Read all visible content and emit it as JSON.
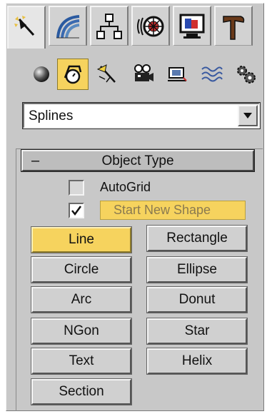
{
  "tabs": [
    {
      "icon": "create-icon",
      "active": true
    },
    {
      "icon": "modify-icon",
      "active": false
    },
    {
      "icon": "hierarchy-icon",
      "active": false
    },
    {
      "icon": "motion-icon",
      "active": false
    },
    {
      "icon": "display-icon",
      "active": false
    },
    {
      "icon": "utilities-icon",
      "active": false
    }
  ],
  "subicons": [
    {
      "icon": "geometry-icon",
      "active": false
    },
    {
      "icon": "shapes-icon",
      "active": true
    },
    {
      "icon": "lights-icon",
      "active": false
    },
    {
      "icon": "cameras-icon",
      "active": false
    },
    {
      "icon": "helpers-icon",
      "active": false
    },
    {
      "icon": "space-warps-icon",
      "active": false
    },
    {
      "icon": "systems-icon",
      "active": false
    }
  ],
  "category_dropdown": {
    "value": "Splines"
  },
  "object_type": {
    "collapse_sign": "–",
    "title": "Object Type",
    "autogrid": {
      "label": "AutoGrid",
      "checked": false
    },
    "start_new_shape": {
      "label": "Start New Shape",
      "checked": true
    },
    "buttons": [
      {
        "label": "Line",
        "active": true
      },
      {
        "label": "Rectangle",
        "active": false
      },
      {
        "label": "Circle",
        "active": false
      },
      {
        "label": "Ellipse",
        "active": false
      },
      {
        "label": "Arc",
        "active": false
      },
      {
        "label": "Donut",
        "active": false
      },
      {
        "label": "NGon",
        "active": false
      },
      {
        "label": "Star",
        "active": false
      },
      {
        "label": "Text",
        "active": false
      },
      {
        "label": "Helix",
        "active": false
      },
      {
        "label": "Section",
        "active": false
      }
    ]
  },
  "colors": {
    "highlight": "#f6d35e",
    "panel": "#c8c8c8"
  }
}
